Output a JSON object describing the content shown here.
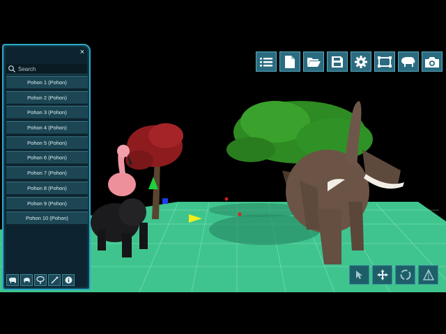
{
  "panel": {
    "close_label": "×",
    "search": {
      "placeholder": "Search",
      "value": ""
    },
    "items": [
      {
        "label": "Pohon 1 (Pohon)"
      },
      {
        "label": "Pohon 2 (Pohon)"
      },
      {
        "label": "Pohon 3 (Pohon)"
      },
      {
        "label": "Pohon 4 (Pohon)"
      },
      {
        "label": "Pohon 5 (Pohon)"
      },
      {
        "label": "Pohon 6 (Pohon)"
      },
      {
        "label": "Pohon 7 (Pohon)"
      },
      {
        "label": "Pohon 8 (Pohon)"
      },
      {
        "label": "Pohon 9 (Pohon)"
      },
      {
        "label": "Pohon 10 (Pohon)"
      }
    ],
    "toolbar_icons": [
      "elephant-icon",
      "animal-icon",
      "tree-icon",
      "wand-icon",
      "info-icon"
    ]
  },
  "toolbar_icons": [
    "list-icon",
    "new-file-icon",
    "open-folder-icon",
    "save-icon",
    "settings-icon",
    "fullscreen-icon",
    "animal-icon",
    "camera-icon"
  ],
  "mode_icons": [
    "select-cursor-icon",
    "move-icon",
    "rotate-icon",
    "scale-icon"
  ],
  "colors": {
    "background": "#000000",
    "ground": "#3ec58e",
    "panel": "#0d2430",
    "panel_border": "#2ea9c4",
    "button": "#2b6b80"
  }
}
